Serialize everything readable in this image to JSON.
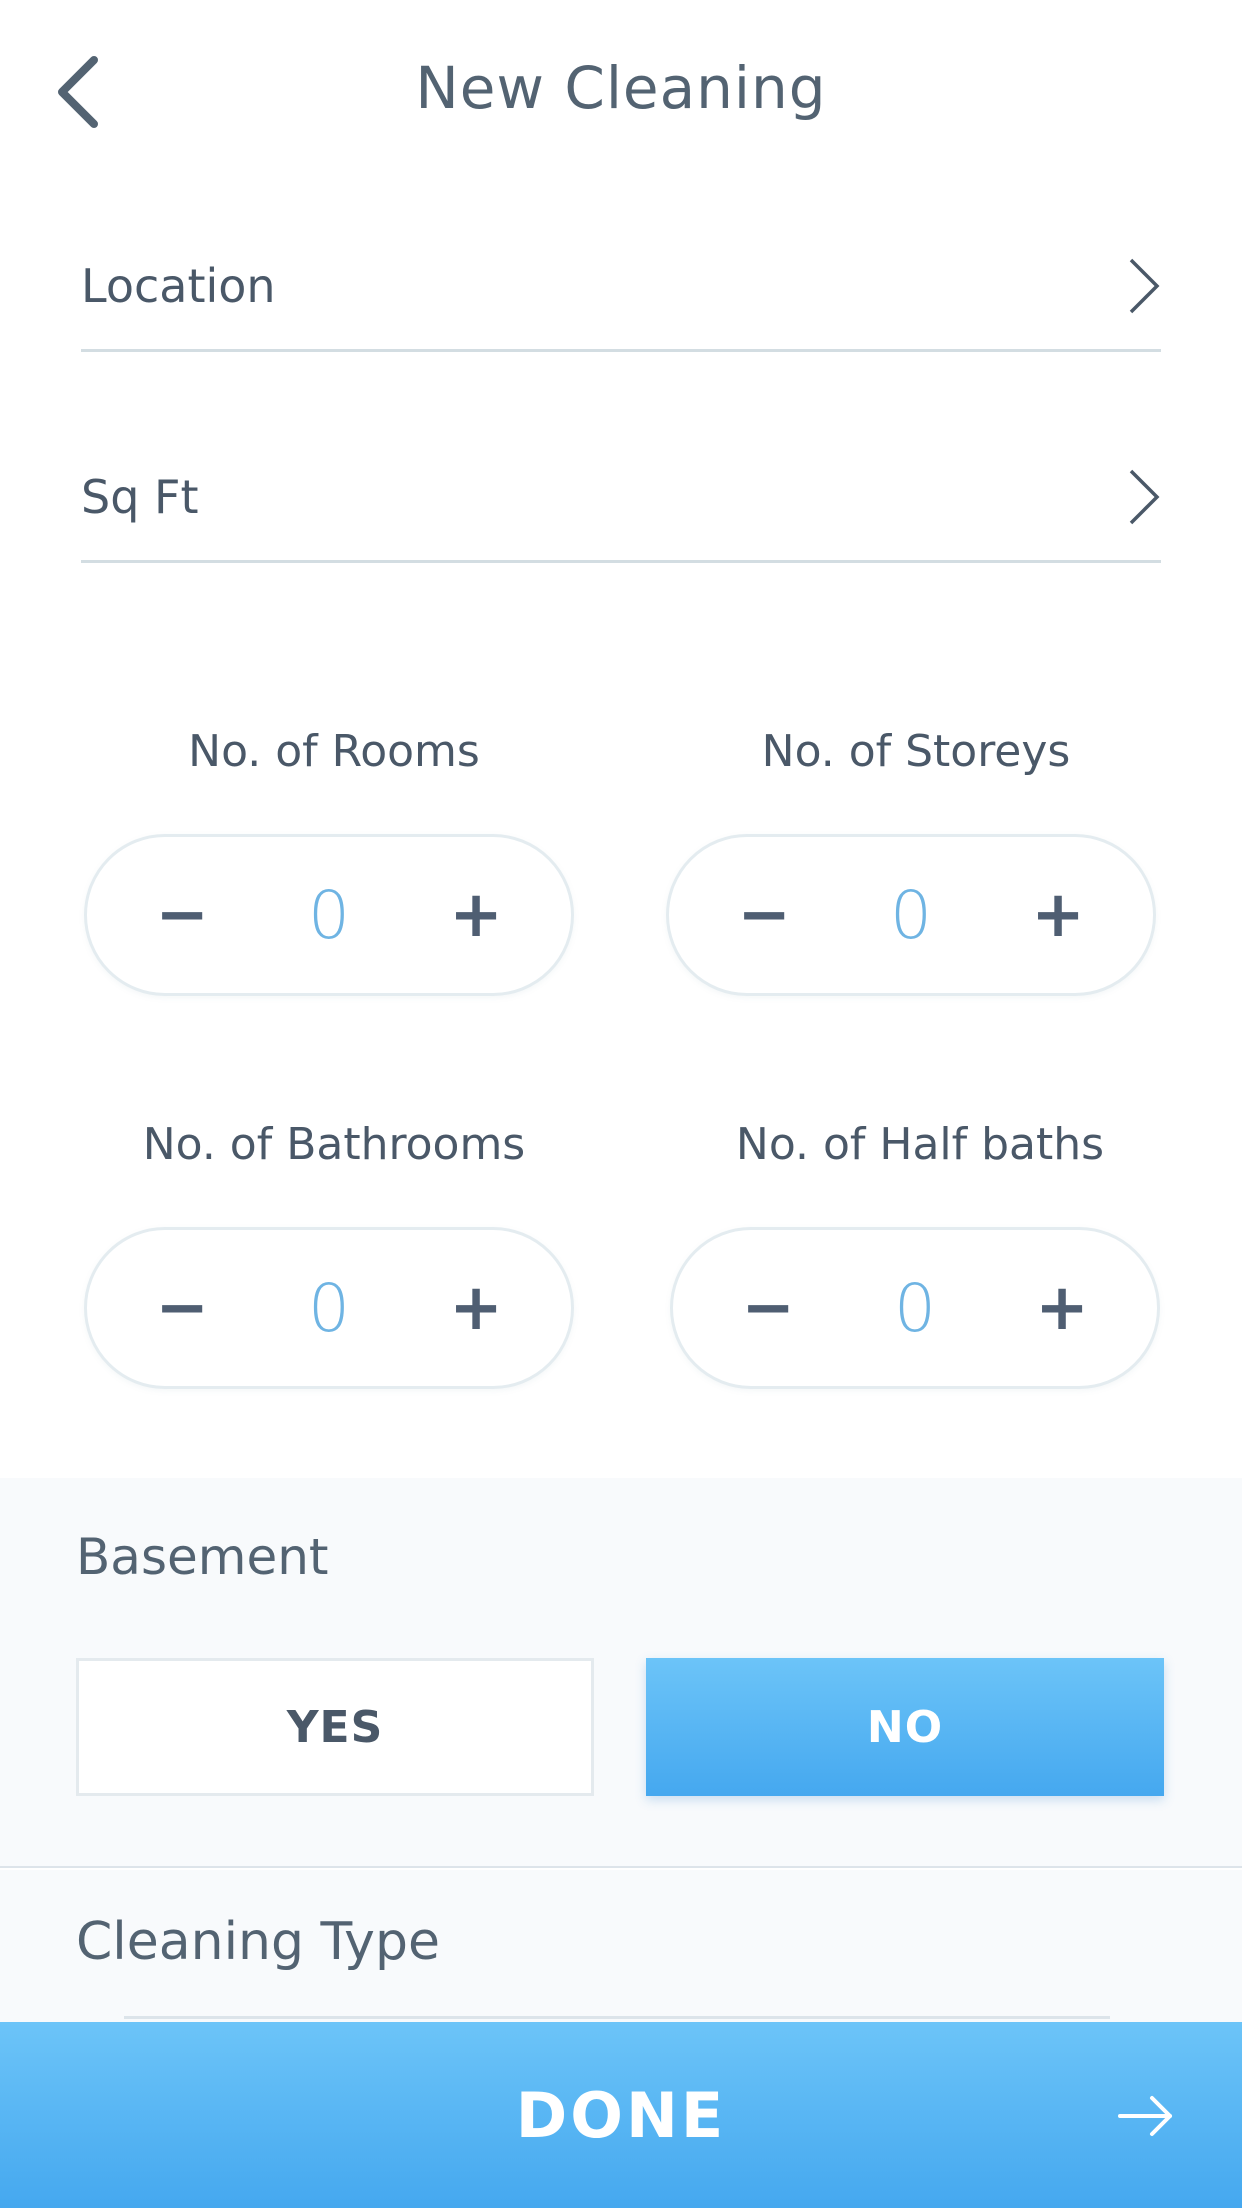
{
  "header": {
    "title": "New Cleaning"
  },
  "rows": {
    "location": {
      "label": "Location"
    },
    "sqft": {
      "label": "Sq Ft"
    }
  },
  "counters": {
    "rooms": {
      "label": "No. of Rooms",
      "value": "0",
      "minus": "−",
      "plus": "+"
    },
    "storeys": {
      "label": "No. of Storeys",
      "value": "0",
      "minus": "−",
      "plus": "+"
    },
    "bathrooms": {
      "label": "No. of Bathrooms",
      "value": "0",
      "minus": "−",
      "plus": "+"
    },
    "half_baths": {
      "label": "No. of Half baths",
      "value": "0",
      "minus": "−",
      "plus": "+"
    }
  },
  "basement": {
    "label": "Basement",
    "yes_label": "YES",
    "no_label": "NO",
    "selected": "NO"
  },
  "cleaning_type": {
    "label": "Cleaning Type"
  },
  "footer": {
    "done_label": "DONE"
  },
  "icons": {
    "back": "chevron-left-icon",
    "row_chevron": "chevron-right-icon",
    "done": "arrow-right-icon"
  },
  "colors": {
    "accent": "#45a8ef",
    "accent_light": "#6cc4f8",
    "value": "#6fb4e3",
    "text": "#4a5868"
  }
}
